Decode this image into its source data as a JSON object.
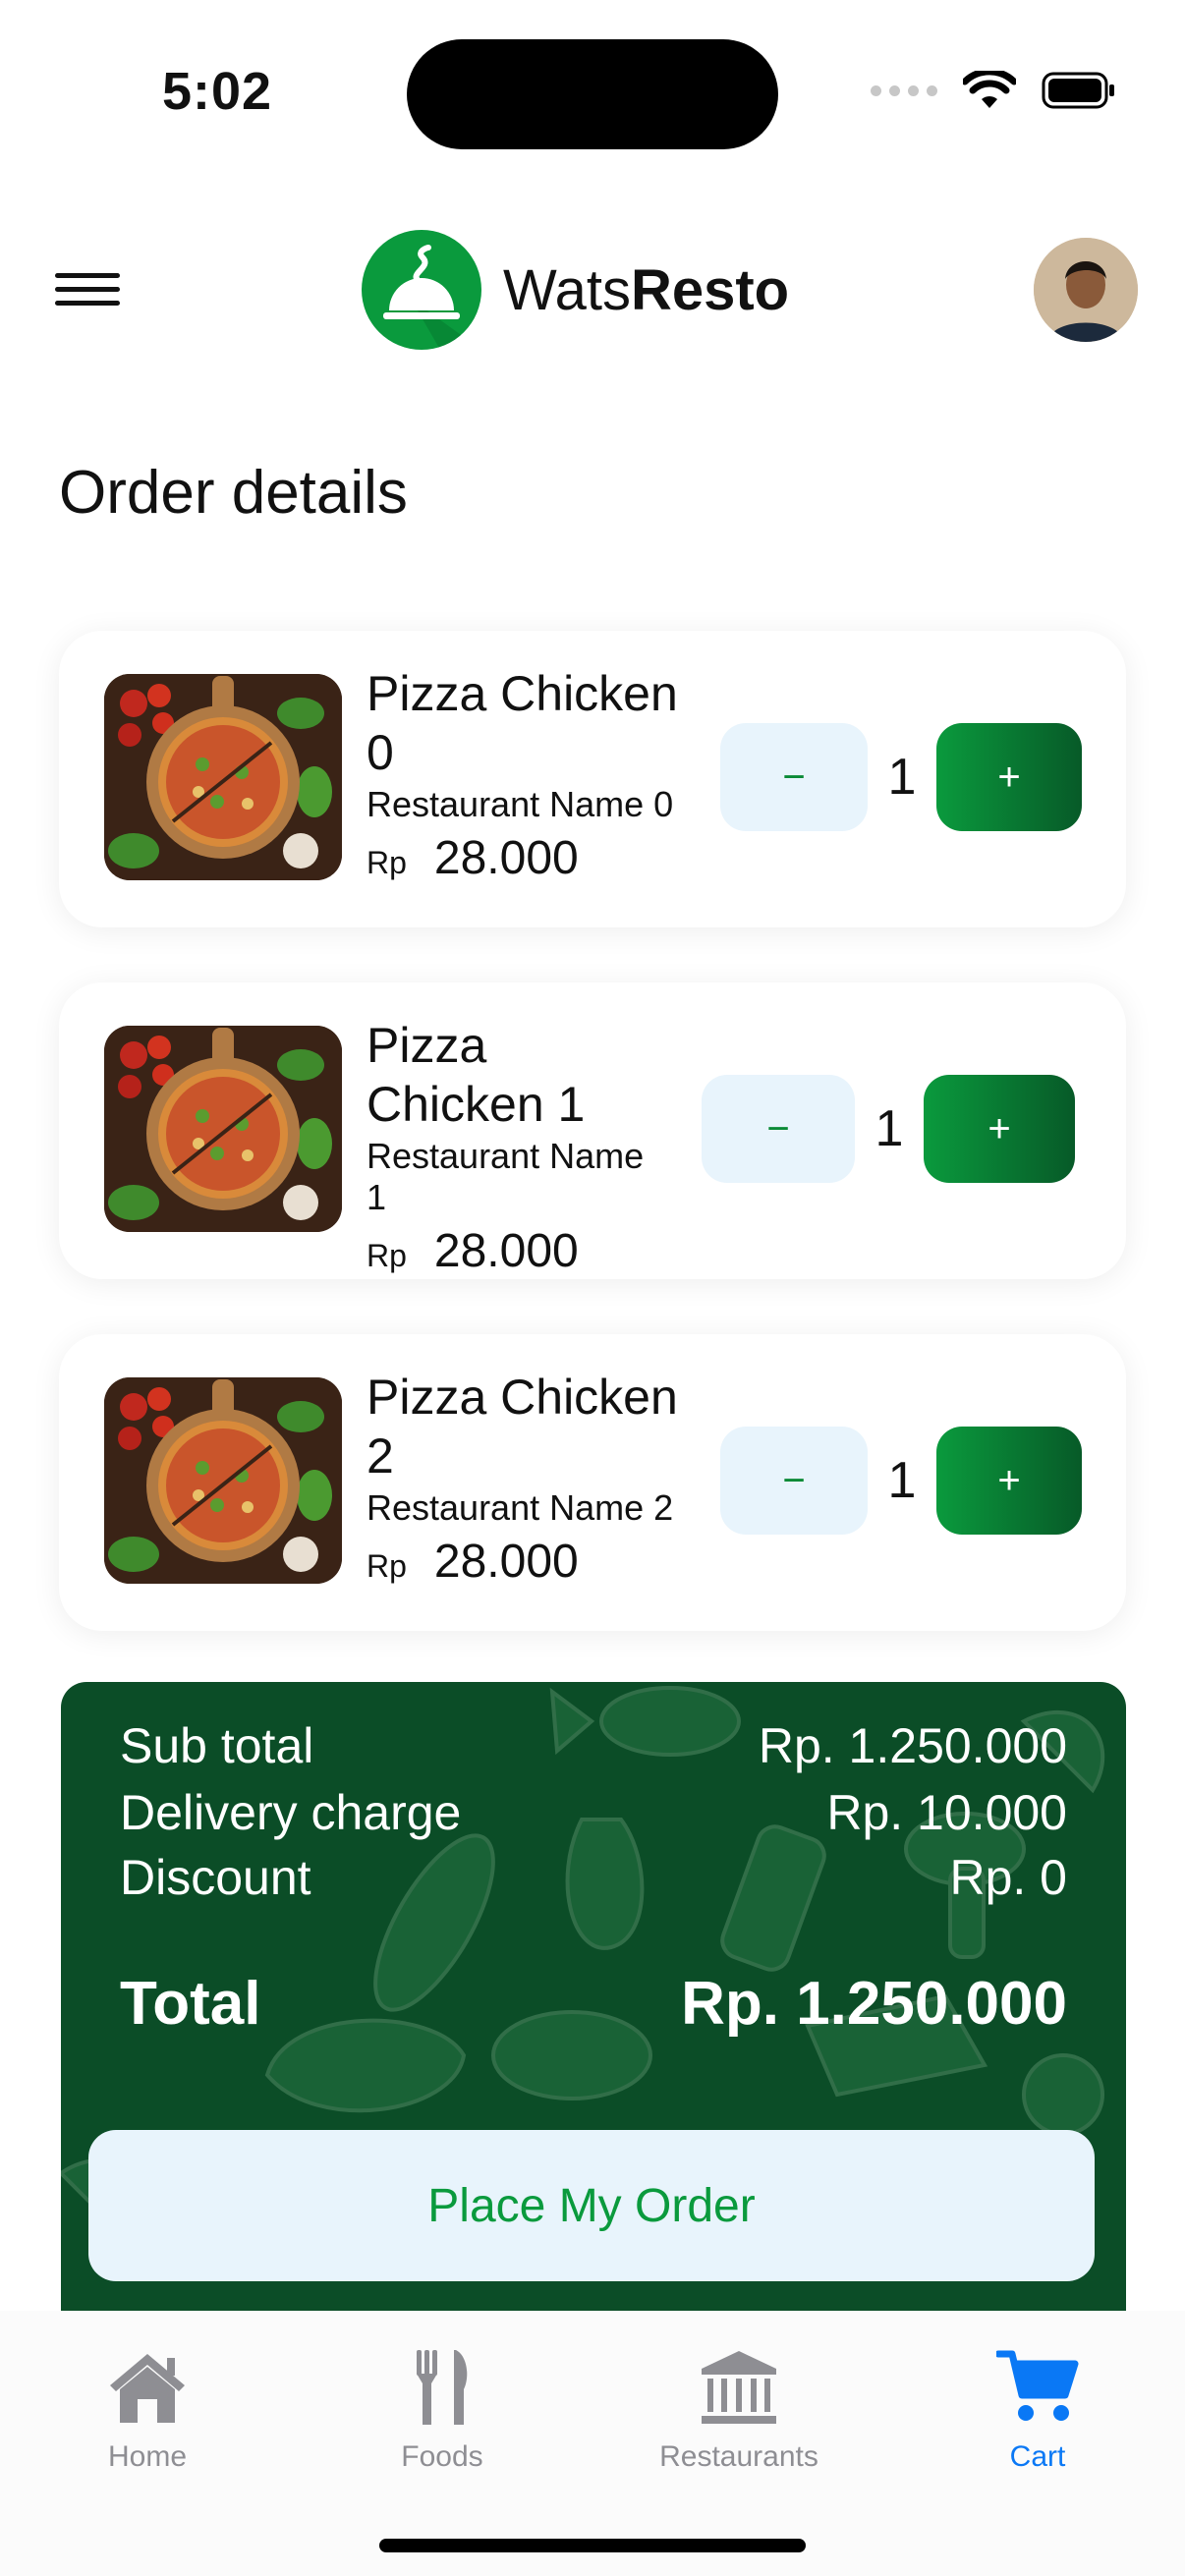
{
  "status_bar": {
    "time": "5:02"
  },
  "header": {
    "brand_light": "Wats",
    "brand_bold": "Resto"
  },
  "page": {
    "title": "Order details"
  },
  "items": [
    {
      "name": "Pizza Chicken 0",
      "restaurant": "Restaurant Name 0",
      "currency": "Rp",
      "price": "28.000",
      "quantity": "1",
      "minus": "−",
      "plus": "+"
    },
    {
      "name": "Pizza Chicken 1",
      "restaurant": "Restaurant Name 1",
      "currency": "Rp",
      "price": "28.000",
      "quantity": "1",
      "minus": "−",
      "plus": "+"
    },
    {
      "name": "Pizza Chicken 2",
      "restaurant": "Restaurant Name 2",
      "currency": "Rp",
      "price": "28.000",
      "quantity": "1",
      "minus": "−",
      "plus": "+"
    }
  ],
  "summary": {
    "subtotal_label": "Sub total",
    "subtotal_value": "Rp. 1.250.000",
    "delivery_label": "Delivery charge",
    "delivery_value": "Rp. 10.000",
    "discount_label": "Discount",
    "discount_value": "Rp. 0",
    "total_label": "Total",
    "total_value": "Rp. 1.250.000",
    "button_label": "Place My Order"
  },
  "nav": [
    {
      "label": "Home",
      "icon": "home-icon"
    },
    {
      "label": "Foods",
      "icon": "fork-knife-icon"
    },
    {
      "label": "Restaurants",
      "icon": "building-columns-icon"
    },
    {
      "label": "Cart",
      "icon": "cart-icon",
      "active": true
    }
  ],
  "colors": {
    "brand_green": "#0a9a3d",
    "dark_green": "#0b4d27",
    "light_blue": "#e8f4fc",
    "active_blue": "#0a78f5",
    "inactive_gray": "#8e8e93"
  }
}
